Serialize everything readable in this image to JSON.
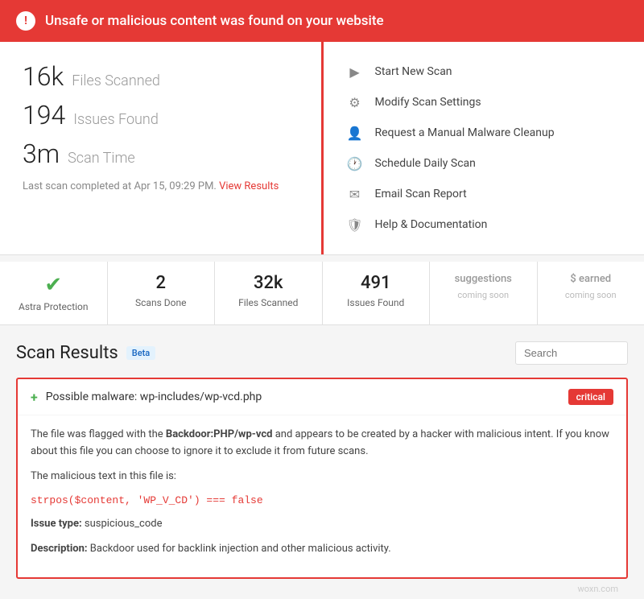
{
  "alert": {
    "icon": "!",
    "message": "Unsafe or malicious content was found on your website"
  },
  "stats": {
    "files_scanned_number": "16k",
    "files_scanned_label": "Files Scanned",
    "issues_found_number": "194",
    "issues_found_label": "Issues Found",
    "scan_time_number": "3m",
    "scan_time_label": "Scan Time",
    "last_scan": "Last scan completed at Apr 15, 09:29 PM.",
    "view_results_label": "View Results"
  },
  "actions": [
    {
      "icon": "▶",
      "label": "Start New Scan"
    },
    {
      "icon": "⚙",
      "label": "Modify Scan Settings"
    },
    {
      "icon": "👤",
      "label": "Request a Manual Malware Cleanup"
    },
    {
      "icon": "🕐",
      "label": "Schedule Daily Scan"
    },
    {
      "icon": "✉",
      "label": "Email Scan Report"
    },
    {
      "icon": "🛡",
      "label": "Help & Documentation"
    }
  ],
  "metrics": [
    {
      "type": "check",
      "value": "✔",
      "label": "Astra Protection"
    },
    {
      "type": "number",
      "value": "2",
      "label": "Scans Done"
    },
    {
      "type": "number",
      "value": "32k",
      "label": "Files Scanned"
    },
    {
      "type": "number",
      "value": "491",
      "label": "Issues Found"
    },
    {
      "type": "coming_soon",
      "value": "suggestions",
      "label": "coming soon"
    },
    {
      "type": "coming_soon",
      "value": "$ earned",
      "label": "coming soon"
    }
  ],
  "scan_results": {
    "title": "Scan Results",
    "beta_label": "Beta",
    "search_placeholder": "Search",
    "result": {
      "title": "Possible malware: wp-includes/wp-vcd.php",
      "badge": "critical",
      "body": "The file was flagged with the Backdoor:PHP/wp-vcd and appears to be created by a hacker with malicious intent. If you know about this file you can choose to ignore it to exclude it from future scans.",
      "malicious_label": "The malicious text in this file is:",
      "malicious_code": "strpos($content, 'WP_V_CD') === false",
      "issue_type_label": "Issue type:",
      "issue_type_value": "suspicious_code",
      "description_label": "Description:",
      "description_value": "Backdoor used for backlink injection and other malicious activity."
    }
  },
  "watermark": "woxn.com"
}
